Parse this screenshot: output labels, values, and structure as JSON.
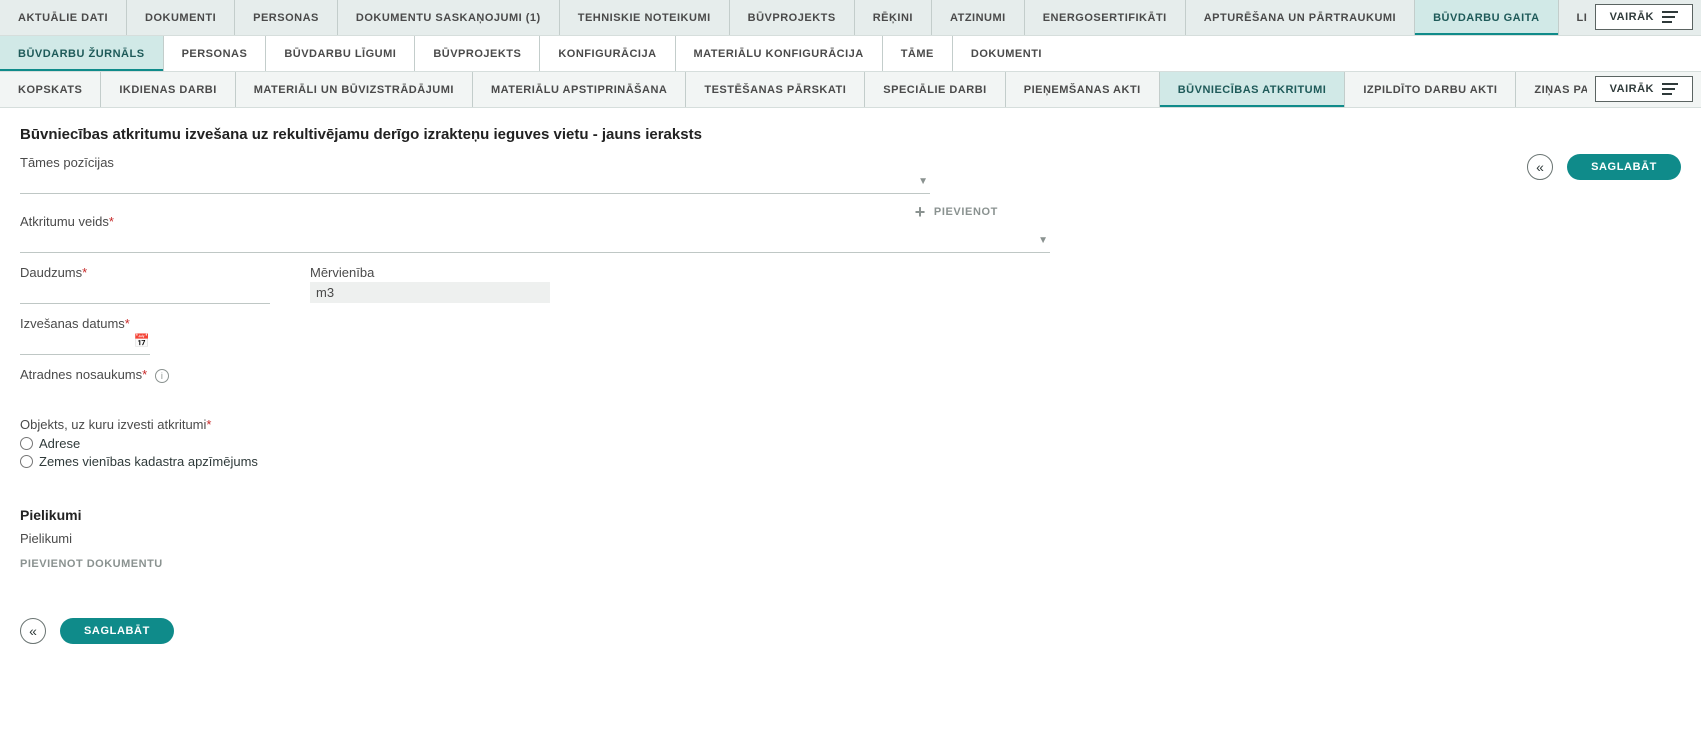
{
  "tabs_level1": {
    "items": [
      {
        "label": "AKTUĀLIE DATI"
      },
      {
        "label": "DOKUMENTI"
      },
      {
        "label": "PERSONAS"
      },
      {
        "label": "DOKUMENTU SASKAŅOJUMI (1)"
      },
      {
        "label": "TEHNISKIE NOTEIKUMI"
      },
      {
        "label": "BŪVPROJEKTS"
      },
      {
        "label": "RĒĶINI"
      },
      {
        "label": "ATZINUMI"
      },
      {
        "label": "ENERGOSERTIFIKĀTI"
      },
      {
        "label": "APTURĒŠANA UN PĀRTRAUKUMI"
      },
      {
        "label": "BŪVDARBU GAITA"
      },
      {
        "label": "LIETAS PILN"
      }
    ],
    "active_index": 10,
    "more_label": "VAIRĀK"
  },
  "tabs_level2": {
    "items": [
      {
        "label": "BŪVDARBU ŽURNĀLS"
      },
      {
        "label": "PERSONAS"
      },
      {
        "label": "BŪVDARBU LĪGUMI"
      },
      {
        "label": "BŪVPROJEKTS"
      },
      {
        "label": "KONFIGURĀCIJA"
      },
      {
        "label": "MATERIĀLU KONFIGURĀCIJA"
      },
      {
        "label": "TĀME"
      },
      {
        "label": "DOKUMENTI"
      }
    ],
    "active_index": 0
  },
  "tabs_level3": {
    "items": [
      {
        "label": "KOPSKATS"
      },
      {
        "label": "IKDIENAS DARBI"
      },
      {
        "label": "MATERIĀLI UN BŪVIZSTRĀDĀJUMI"
      },
      {
        "label": "MATERIĀLU APSTIPRINĀŠANA"
      },
      {
        "label": "TESTĒŠANAS PĀRSKATI"
      },
      {
        "label": "SPECIĀLIE DARBI"
      },
      {
        "label": "PIEŅEMŠANAS AKTI"
      },
      {
        "label": "BŪVNIECĪBAS ATKRITUMI"
      },
      {
        "label": "IZPILDĪTO DARBU AKTI"
      },
      {
        "label": "ZIŅAS PAR AVĀRIJU"
      }
    ],
    "active_index": 7,
    "more_label": "VAIRĀK"
  },
  "page": {
    "title": "Būvniecības atkritumu izvešana uz rekultivējamu derīgo izrakteņu ieguves vietu - jauns ieraksts"
  },
  "form": {
    "tames_label": "Tāmes pozīcijas",
    "add_label": "PIEVIENOT",
    "atkritumu_veids_label": "Atkritumu veids",
    "daudzums_label": "Daudzums",
    "mervieniba_label": "Mērvienība",
    "mervieniba_value": "m3",
    "izvesanas_datums_label": "Izvešanas datums",
    "atradnes_label": "Atradnes nosaukums",
    "objekts_label": "Objekts, uz kuru izvesti atkritumi",
    "radio_adrese": "Adrese",
    "radio_kadastrs": "Zemes vienības kadastra apzīmējums"
  },
  "attachments": {
    "heading": "Pielikumi",
    "label": "Pielikumi",
    "add_doc_label": "PIEVIENOT DOKUMENTU"
  },
  "actions": {
    "save_label": "SAGLABĀT"
  }
}
